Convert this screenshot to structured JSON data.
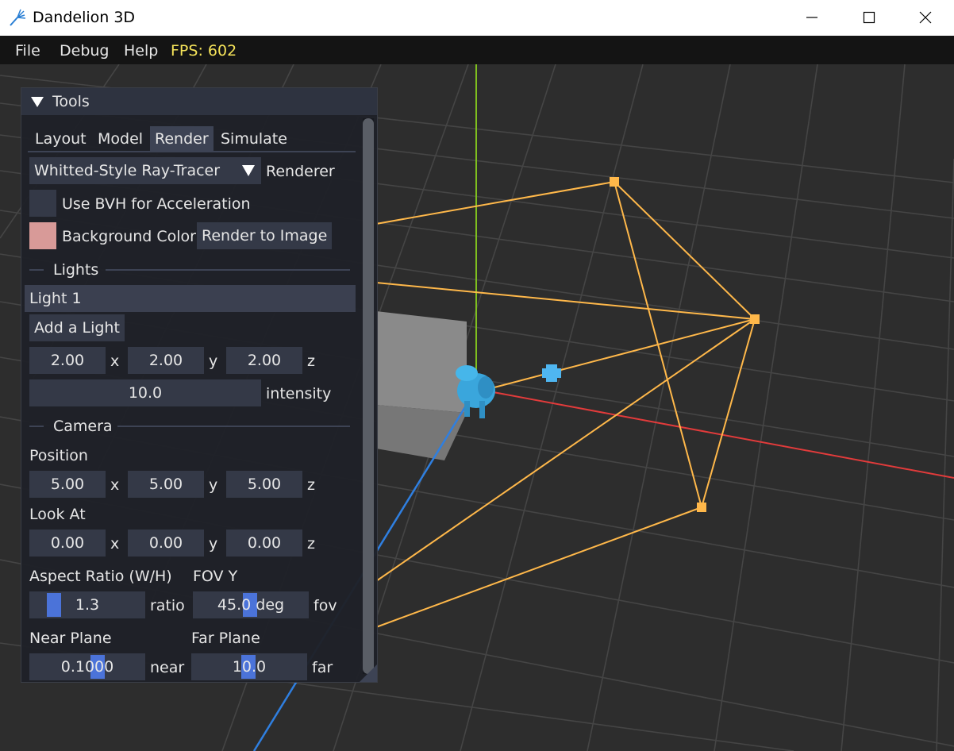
{
  "window": {
    "title": "Dandelion 3D",
    "controls": [
      "minimize-icon",
      "maximize-icon",
      "close-icon"
    ]
  },
  "menubar": {
    "items": [
      "File",
      "Debug",
      "Help"
    ],
    "fps": "FPS: 602"
  },
  "tools": {
    "header": "Tools",
    "tabs": [
      "Layout",
      "Model",
      "Render",
      "Simulate"
    ],
    "active_tab": "Render",
    "renderer": {
      "value": "Whitted-Style Ray-Tracer",
      "label": "Renderer"
    },
    "bvh_label": "Use BVH for Acceleration",
    "bvh_checked": false,
    "background_color_label": "Background Color",
    "background_color": "#d89a98",
    "render_to_image": "Render to Image",
    "lights": {
      "section": "Lights",
      "selected_light": "Light 1",
      "add_light": "Add a Light",
      "x": "2.00",
      "x_label": "x",
      "y": "2.00",
      "y_label": "y",
      "z": "2.00",
      "z_label": "z",
      "intensity": "10.0",
      "intensity_label": "intensity"
    },
    "camera": {
      "section": "Camera",
      "position_label": "Position",
      "position": {
        "x": "5.00",
        "y": "5.00",
        "z": "5.00"
      },
      "look_at_label": "Look At",
      "look_at": {
        "x": "0.00",
        "y": "0.00",
        "z": "0.00"
      },
      "axis_labels": {
        "x": "x",
        "y": "y",
        "z": "z"
      },
      "aspect_label": "Aspect Ratio (W/H)",
      "aspect": "1.3",
      "aspect_unit": "ratio",
      "fov_label": "FOV Y",
      "fov": "45.0 deg",
      "fov_unit": "fov",
      "near_label": "Near Plane",
      "near": "0.1000",
      "near_unit": "near",
      "far_label": "Far Plane",
      "far": "10.0",
      "far_unit": "far"
    }
  },
  "colors": {
    "frustum": "#ffb84a",
    "axis_x": "#e23b3b",
    "axis_y": "#7fbf1f",
    "axis_z": "#2f7fe0",
    "light_marker": "#4fb6f0",
    "fps": "#f5e35a",
    "accent": "#4b73d9"
  }
}
